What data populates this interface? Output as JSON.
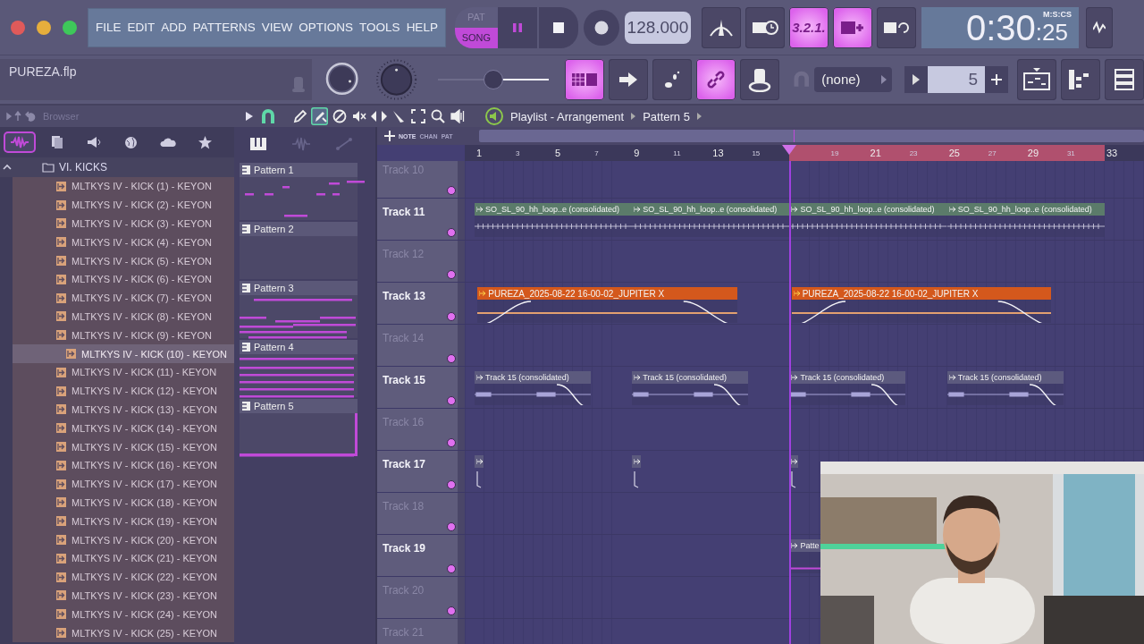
{
  "menu": [
    "FILE",
    "EDIT",
    "ADD",
    "PATTERNS",
    "VIEW",
    "OPTIONS",
    "TOOLS",
    "HELP"
  ],
  "mode_switch": [
    {
      "label": "PAT",
      "selected": false
    },
    {
      "label": "SONG",
      "selected": true
    }
  ],
  "tempo": "128.000",
  "top_buttons": [
    {
      "kind": "metronome",
      "on": false
    },
    {
      "kind": "wait",
      "on": false
    },
    {
      "kind": "countdown",
      "label": "3.2.1.",
      "on": true
    },
    {
      "kind": "overdub",
      "on": true
    },
    {
      "kind": "loop-record",
      "on": false
    }
  ],
  "time": {
    "main": "0:30",
    "sub": ":25",
    "format": "M:S:CS"
  },
  "file_name": "PUREZA.flp",
  "master_slider": {
    "level": 0.5
  },
  "tool_buttons": [
    {
      "kind": "typing-keyboard",
      "on": true
    },
    {
      "kind": "arrow",
      "on": false
    },
    {
      "kind": "steps",
      "on": false
    },
    {
      "kind": "link",
      "on": true
    },
    {
      "kind": "knob",
      "on": false
    }
  ],
  "preset": "(none)",
  "pattern_number": "5",
  "window_buttons": [
    {
      "kind": "playlist"
    },
    {
      "kind": "channel-rack"
    },
    {
      "kind": "mixer"
    }
  ],
  "browser": {
    "title": "Browser",
    "tabs": [
      {
        "kind": "wave",
        "selected": true
      },
      {
        "kind": "files",
        "selected": false
      },
      {
        "kind": "speaker",
        "selected": false
      },
      {
        "kind": "globe",
        "selected": false
      },
      {
        "kind": "cloud",
        "selected": false
      },
      {
        "kind": "star",
        "selected": false
      }
    ],
    "folder": "VI. KICKS",
    "items": [
      {
        "name": "MLTKYS IV - KICK (1) - KEYON",
        "selected": false
      },
      {
        "name": "MLTKYS IV - KICK (2) - KEYON",
        "selected": false
      },
      {
        "name": "MLTKYS IV - KICK (3) - KEYON",
        "selected": false
      },
      {
        "name": "MLTKYS IV - KICK (4) - KEYON",
        "selected": false
      },
      {
        "name": "MLTKYS IV - KICK (5) - KEYON",
        "selected": false
      },
      {
        "name": "MLTKYS IV - KICK (6) - KEYON",
        "selected": false
      },
      {
        "name": "MLTKYS IV - KICK (7) - KEYON",
        "selected": false
      },
      {
        "name": "MLTKYS IV - KICK (8) - KEYON",
        "selected": false
      },
      {
        "name": "MLTKYS IV - KICK (9) - KEYON",
        "selected": false
      },
      {
        "name": "MLTKYS IV - KICK (10) - KEYON",
        "selected": true
      },
      {
        "name": "MLTKYS IV - KICK (11) - KEYON",
        "selected": false
      },
      {
        "name": "MLTKYS IV - KICK (12) - KEYON",
        "selected": false
      },
      {
        "name": "MLTKYS IV - KICK (13) - KEYON",
        "selected": false
      },
      {
        "name": "MLTKYS IV - KICK (14) - KEYON",
        "selected": false
      },
      {
        "name": "MLTKYS IV - KICK (15) - KEYON",
        "selected": false
      },
      {
        "name": "MLTKYS IV - KICK (16) - KEYON",
        "selected": false
      },
      {
        "name": "MLTKYS IV - KICK (17) - KEYON",
        "selected": false
      },
      {
        "name": "MLTKYS IV - KICK (18) - KEYON",
        "selected": false
      },
      {
        "name": "MLTKYS IV - KICK (19) - KEYON",
        "selected": false
      },
      {
        "name": "MLTKYS IV - KICK (20) - KEYON",
        "selected": false
      },
      {
        "name": "MLTKYS IV - KICK (21) - KEYON",
        "selected": false
      },
      {
        "name": "MLTKYS IV - KICK (22) - KEYON",
        "selected": false
      },
      {
        "name": "MLTKYS IV - KICK (23) - KEYON",
        "selected": false
      },
      {
        "name": "MLTKYS IV - KICK (24) - KEYON",
        "selected": false
      },
      {
        "name": "MLTKYS IV - KICK (25) - KEYON",
        "selected": false
      }
    ]
  },
  "playlist": {
    "title": "Playlist - Arrangement",
    "crumb": "Pattern 5",
    "tools": [
      {
        "kind": "pencil",
        "selected": false
      },
      {
        "kind": "paint",
        "selected": true
      },
      {
        "kind": "delete",
        "selected": false
      },
      {
        "kind": "mute",
        "selected": false
      },
      {
        "kind": "slip",
        "selected": false
      },
      {
        "kind": "slice",
        "selected": false
      },
      {
        "kind": "select",
        "selected": false
      },
      {
        "kind": "zoom",
        "selected": false
      },
      {
        "kind": "speaker",
        "selected": false
      }
    ],
    "patterns": [
      {
        "name": "Pattern 1",
        "selected": false
      },
      {
        "name": "Pattern 2",
        "selected": false
      },
      {
        "name": "Pattern 3",
        "selected": false
      },
      {
        "name": "Pattern 4",
        "selected": false
      },
      {
        "name": "Pattern 5",
        "selected": true
      }
    ],
    "modes": [
      {
        "label": "NOTE",
        "selected": true
      },
      {
        "label": "CHAN",
        "selected": false
      },
      {
        "label": "PAT",
        "selected": false
      }
    ],
    "ruler": [
      {
        "label": "1",
        "kind": "major"
      },
      {
        "label": "3",
        "kind": "minor"
      },
      {
        "label": "5",
        "kind": "major"
      },
      {
        "label": "7",
        "kind": "minor"
      },
      {
        "label": "9",
        "kind": "major"
      },
      {
        "label": "11",
        "kind": "minor"
      },
      {
        "label": "13",
        "kind": "major"
      },
      {
        "label": "15",
        "kind": "minor"
      },
      {
        "label": "19",
        "kind": "minor"
      },
      {
        "label": "21",
        "kind": "major"
      },
      {
        "label": "23",
        "kind": "minor"
      },
      {
        "label": "25",
        "kind": "major"
      },
      {
        "label": "27",
        "kind": "minor"
      },
      {
        "label": "29",
        "kind": "major"
      },
      {
        "label": "31",
        "kind": "minor"
      },
      {
        "label": "33",
        "kind": "major"
      }
    ],
    "tracks": [
      {
        "name": "Track 10",
        "empty": true
      },
      {
        "name": "Track 11",
        "empty": false,
        "clips": [
          {
            "kind": "ticks",
            "label": "SO_SL_90_hh_loop..e (consolidated)",
            "color": "#5b7b6a"
          },
          {
            "kind": "ticks",
            "label": "SO_SL_90_hh_loop..e (consolidated)",
            "color": "#5b7b6a"
          },
          {
            "kind": "ticks",
            "label": "SO_SL_90_hh_loop..e (consolidated)",
            "color": "#5b7b6a"
          },
          {
            "kind": "ticks",
            "label": "SO_SL_90_hh_loop..e (consolidated)",
            "color": "#5b7b6a"
          }
        ]
      },
      {
        "name": "Track 12",
        "empty": true
      },
      {
        "name": "Track 13",
        "empty": false,
        "clips": [
          {
            "kind": "fades",
            "label": "PUREZA_2025-08-22 16-00-02_JUPITER X",
            "color": "#d4581c"
          },
          {
            "kind": "fades",
            "label": "PUREZA_2025-08-22 16-00-02_JUPITER X",
            "color": "#d4581c"
          }
        ]
      },
      {
        "name": "Track 14",
        "empty": true
      },
      {
        "name": "Track 15",
        "empty": false,
        "clips": [
          {
            "kind": "fadeout",
            "label": "Track 15 (consolidated)",
            "color": "#5c5a7e"
          },
          {
            "kind": "fadeout",
            "label": "Track 15 (consolidated)",
            "color": "#5c5a7e"
          },
          {
            "kind": "fadeout",
            "label": "Track 15 (consolidated)",
            "color": "#5c5a7e"
          },
          {
            "kind": "fadeout",
            "label": "Track 15 (consolidated)",
            "color": "#5c5a7e"
          }
        ]
      },
      {
        "name": "Track 16",
        "empty": true
      },
      {
        "name": "Track 17",
        "empty": false,
        "clips": [
          {
            "kind": "stub",
            "color": "#5c5a7e"
          },
          {
            "kind": "stub",
            "color": "#5c5a7e"
          },
          {
            "kind": "stub",
            "color": "#5c5a7e"
          }
        ]
      },
      {
        "name": "Track 18",
        "empty": true
      },
      {
        "name": "Track 19",
        "empty": false,
        "clips": [
          {
            "kind": "plain",
            "label": "Patte",
            "color": "#5c5a7e"
          }
        ]
      },
      {
        "name": "Track 20",
        "empty": true
      },
      {
        "name": "Track 21",
        "empty": true
      }
    ]
  },
  "webcam": {
    "kind": "picture"
  }
}
